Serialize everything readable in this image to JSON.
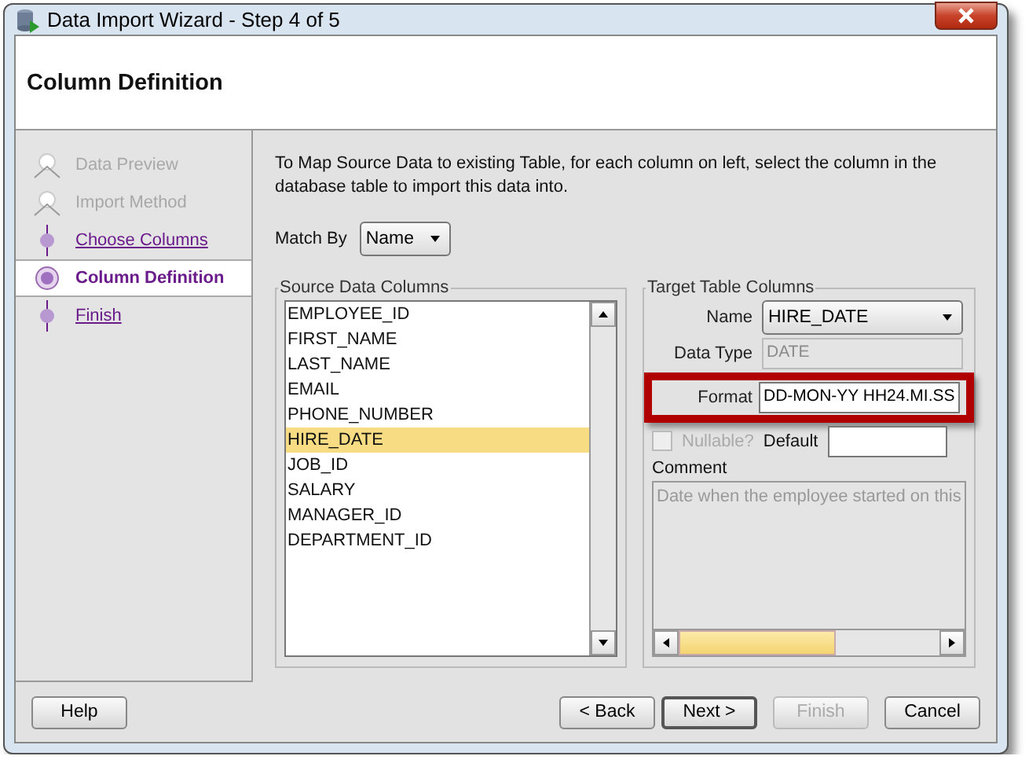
{
  "window": {
    "title": "Data Import Wizard - Step 4 of 5"
  },
  "header": {
    "title": "Column Definition"
  },
  "steps": [
    {
      "label": "Data Preview",
      "disabled": true,
      "selected": false
    },
    {
      "label": "Import Method",
      "disabled": true,
      "selected": false
    },
    {
      "label": "Choose Columns",
      "disabled": false,
      "selected": false
    },
    {
      "label": "Column Definition",
      "disabled": false,
      "selected": true
    },
    {
      "label": "Finish",
      "disabled": false,
      "selected": false
    }
  ],
  "instructions": "To Map Source Data to existing Table, for each column on left, select the column in the database table to import this data into.",
  "match_by": {
    "label": "Match By",
    "value": "Name"
  },
  "source": {
    "legend": "Source Data Columns",
    "items": [
      {
        "label": "EMPLOYEE_ID",
        "selected": false
      },
      {
        "label": "FIRST_NAME",
        "selected": false
      },
      {
        "label": "LAST_NAME",
        "selected": false
      },
      {
        "label": "EMAIL",
        "selected": false
      },
      {
        "label": "PHONE_NUMBER",
        "selected": false
      },
      {
        "label": "HIRE_DATE",
        "selected": true
      },
      {
        "label": "JOB_ID",
        "selected": false
      },
      {
        "label": "SALARY",
        "selected": false
      },
      {
        "label": "MANAGER_ID",
        "selected": false
      },
      {
        "label": "DEPARTMENT_ID",
        "selected": false
      }
    ]
  },
  "target": {
    "legend": "Target Table Columns",
    "name": {
      "label": "Name",
      "value": "HIRE_DATE"
    },
    "data_type": {
      "label": "Data Type",
      "value": "DATE",
      "disabled": true
    },
    "format": {
      "label": "Format",
      "value": "DD-MON-YY HH24.MI.SS",
      "highlighted": true
    },
    "nullable": {
      "label": "Nullable?",
      "checked": false,
      "disabled": true
    },
    "default": {
      "label": "Default"
    },
    "comment": {
      "label": "Comment",
      "value": "Date when the employee started on this",
      "disabled": true
    }
  },
  "buttons": [
    {
      "label": "Help",
      "disabled": false
    },
    {
      "label": "< Back",
      "disabled": false
    },
    {
      "label": "Next >",
      "disabled": false,
      "default": true
    },
    {
      "label": "Finish",
      "disabled": true
    },
    {
      "label": "Cancel",
      "disabled": false
    }
  ]
}
